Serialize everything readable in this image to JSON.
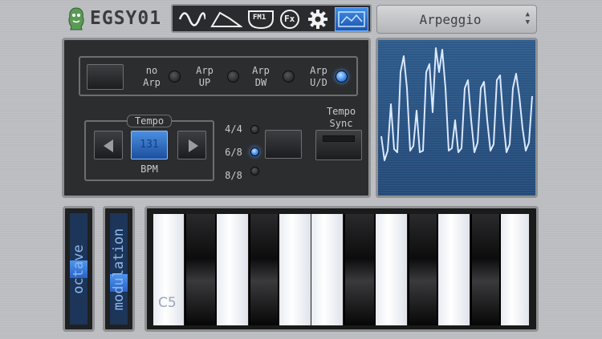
{
  "app": {
    "logo_text": "EGSY01"
  },
  "toolbar": {
    "buttons": [
      {
        "name": "waveform",
        "icon": "sine-wave-icon"
      },
      {
        "name": "envelope",
        "icon": "envelope-icon"
      },
      {
        "name": "fm1",
        "label": "FM1"
      },
      {
        "name": "fx",
        "label": "Fx"
      },
      {
        "name": "settings",
        "icon": "gear-icon"
      },
      {
        "name": "wave-display",
        "icon": "wave-display-icon",
        "active": true
      }
    ]
  },
  "preset": {
    "label": "Arpeggio"
  },
  "arp": {
    "modes": [
      {
        "label1": "no",
        "label2": "Arp",
        "active": false
      },
      {
        "label1": "Arp",
        "label2": "UP",
        "active": false
      },
      {
        "label1": "Arp",
        "label2": "DW",
        "active": false
      },
      {
        "label1": "Arp",
        "label2": "U/D",
        "active": true
      }
    ],
    "tempo_title": "Tempo",
    "tempo_value": "131",
    "bpm_label": "BPM",
    "time_signatures": [
      {
        "label": "4/4",
        "active": false
      },
      {
        "label": "6/8",
        "active": true
      },
      {
        "label": "8/8",
        "active": false
      }
    ],
    "sync_line1": "Tempo",
    "sync_line2": "Sync"
  },
  "sliders": {
    "octave": {
      "label": "octave",
      "value": 0.5
    },
    "modulation": {
      "label": "modulation",
      "value": 0.35
    }
  },
  "keyboard": {
    "octave_label": "C5"
  },
  "colors": {
    "accent": "#3f8ef0",
    "panel": "#2c2d2f"
  }
}
